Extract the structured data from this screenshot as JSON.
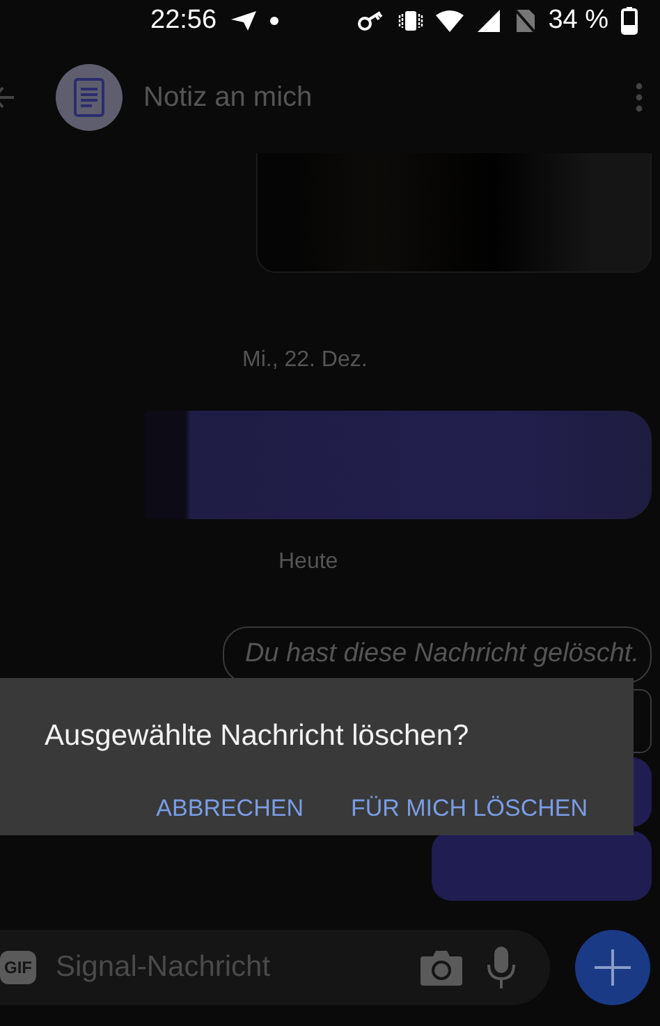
{
  "status_bar": {
    "time": "22:56",
    "battery": "34 %"
  },
  "header": {
    "title": "Notiz an mich"
  },
  "messages": [
    {
      "kind": "redacted_incoming"
    },
    {
      "kind": "date",
      "text": "Mi., 22. Dez."
    },
    {
      "kind": "redacted_outgoing"
    },
    {
      "kind": "date",
      "text": "Heute"
    },
    {
      "kind": "deleted",
      "text": "Du hast diese Nachricht gelöscht."
    },
    {
      "kind": "covered_dark"
    },
    {
      "kind": "covered_outgoing"
    },
    {
      "kind": "covered_outgoing"
    }
  ],
  "composer": {
    "gif": "GIF",
    "placeholder": "Signal-Nachricht"
  },
  "dialog": {
    "title": "Ausgewählte Nachricht löschen?",
    "buttons": [
      "ABBRECHEN",
      "FÜR MICH LÖSCHEN"
    ]
  }
}
